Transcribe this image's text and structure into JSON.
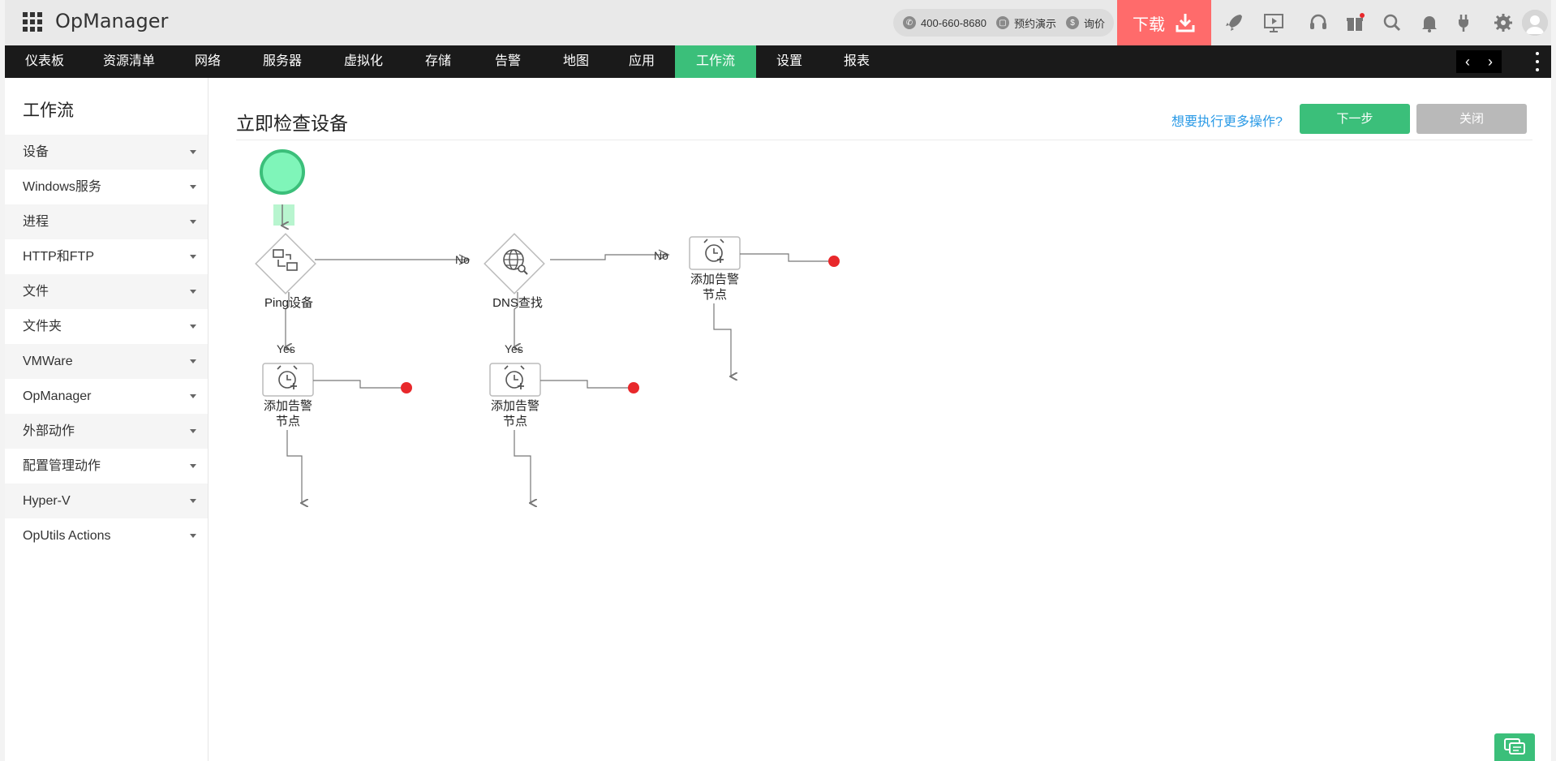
{
  "header": {
    "brand": "OpManager",
    "phone": "400-660-8680",
    "demo": "预约演示",
    "quote": "询价",
    "download_label": "下载"
  },
  "nav": {
    "items": [
      "仪表板",
      "资源清单",
      "网络",
      "服务器",
      "虚拟化",
      "存储",
      "告警",
      "地图",
      "应用",
      "工作流",
      "设置",
      "报表"
    ],
    "active": "工作流"
  },
  "sidebar": {
    "title": "工作流",
    "items": [
      "设备",
      "Windows服务",
      "进程",
      "HTTP和FTP",
      "文件",
      "文件夹",
      "VMWare",
      "OpManager",
      "外部动作",
      "配置管理动作",
      "Hyper-V",
      "OpUtils Actions"
    ]
  },
  "main": {
    "title": "立即检查设备",
    "more_link": "想要执行更多操作?",
    "next_label": "下一步",
    "close_label": "关闭"
  },
  "workflow": {
    "nodes": {
      "ping": "Ping设备",
      "dns": "DNS查找",
      "alarm_line1": "添加告警",
      "alarm_line2": "节点"
    },
    "edges": {
      "no": "No",
      "yes": "Yes"
    }
  },
  "colors": {
    "accent": "#3bbf7a",
    "download": "#ff6b6b",
    "link": "#2a9ae6",
    "endpoint": "#e8282b",
    "start": "#7ff5b9"
  }
}
